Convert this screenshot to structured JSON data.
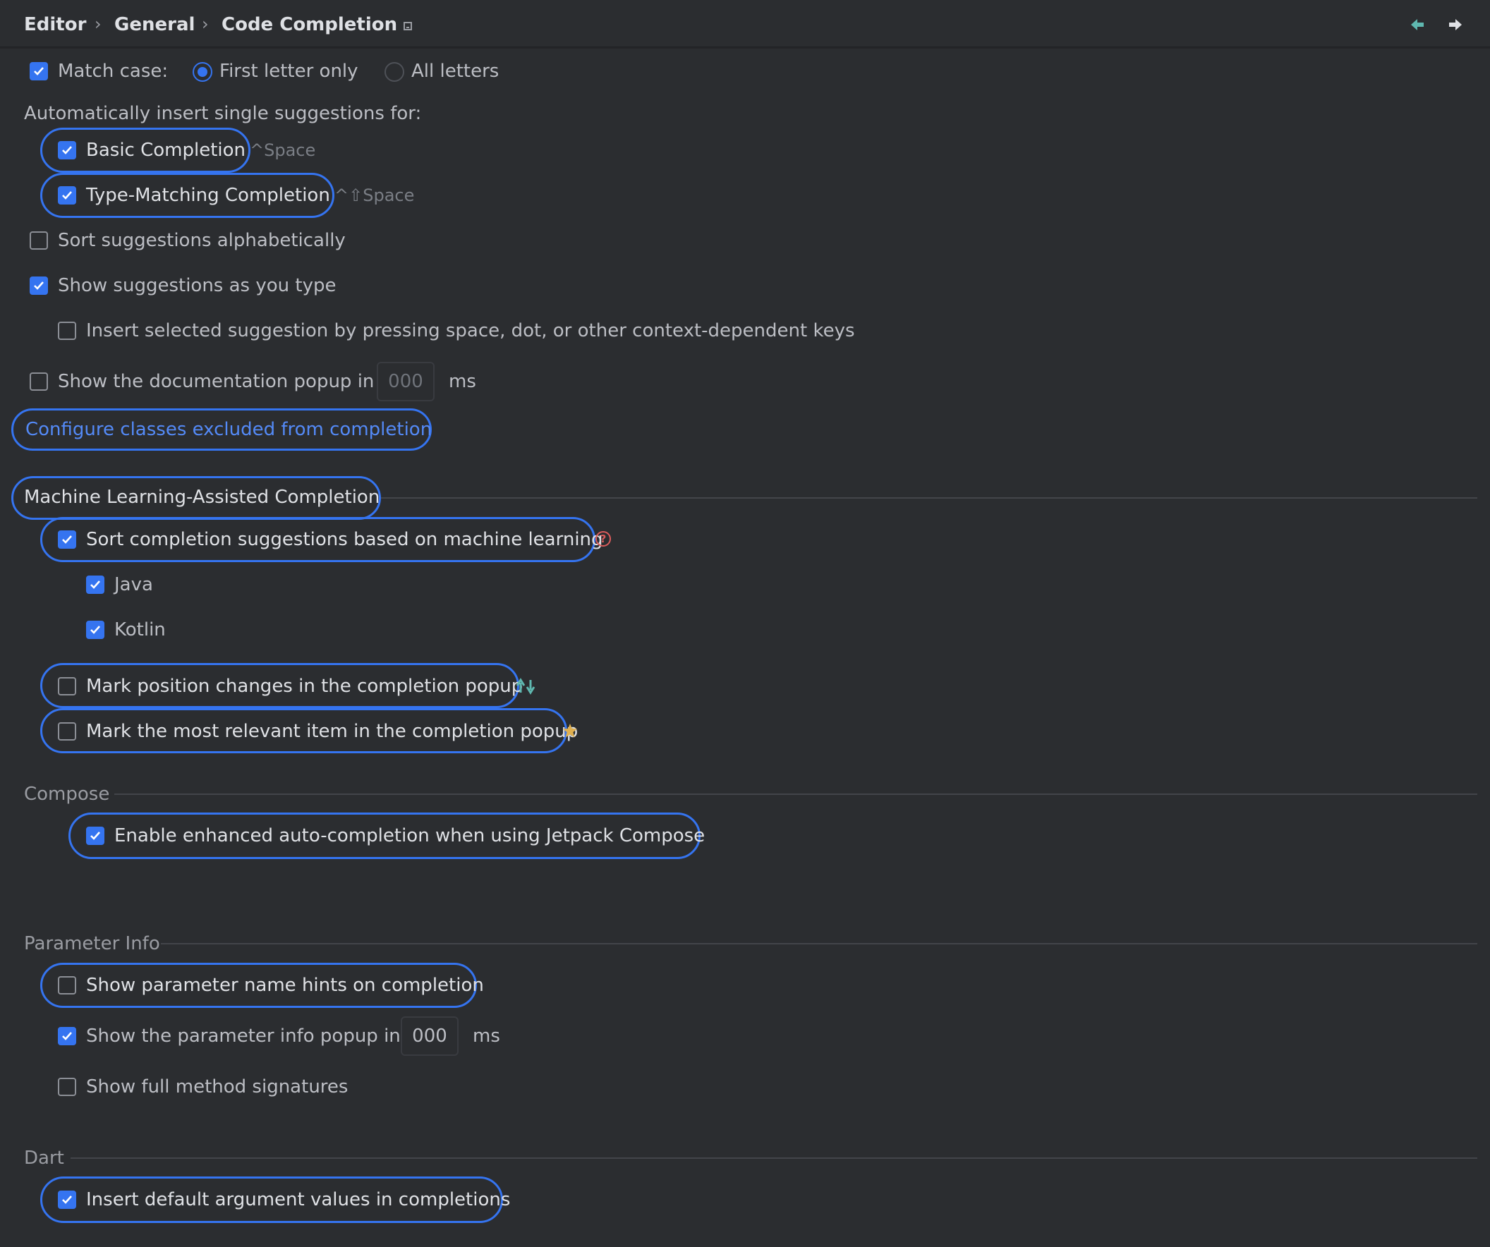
{
  "breadcrumb": [
    "Editor",
    "General",
    "Code Completion"
  ],
  "colors": {
    "accent": "#3574f0",
    "link": "#548af7",
    "background": "#2b2d30",
    "help": "#db5c5c",
    "star": "#e0b050",
    "arrows": "#5fb8b0"
  },
  "match_case": {
    "label": "Match case:",
    "checked": true,
    "options": [
      "First letter only",
      "All letters"
    ],
    "selected": "First letter only"
  },
  "auto_insert": {
    "heading": "Automatically insert single suggestions for:",
    "basic": {
      "label": "Basic Completion",
      "shortcut": "^Space",
      "checked": true
    },
    "type_matching": {
      "label": "Type-Matching Completion",
      "shortcut": "^⇧Space",
      "checked": true
    }
  },
  "sort_alpha": {
    "label": "Sort suggestions alphabetically",
    "checked": false
  },
  "show_as_type": {
    "label": "Show suggestions as you type",
    "checked": true
  },
  "insert_selected": {
    "label": "Insert selected suggestion by pressing space, dot, or other context-dependent keys",
    "checked": false
  },
  "doc_popup": {
    "label": "Show the documentation popup in",
    "value": "000",
    "unit": "ms",
    "checked": false
  },
  "configure_link": "Configure classes excluded from completion",
  "ml": {
    "title": "Machine Learning-Assisted Completion",
    "sort_ml": {
      "label": "Sort completion suggestions based on machine learning",
      "checked": true,
      "help": "?"
    },
    "java": {
      "label": "Java",
      "checked": true
    },
    "kotlin": {
      "label": "Kotlin",
      "checked": true
    },
    "mark_position": {
      "label": "Mark position changes in the completion popup",
      "checked": false,
      "icon": "up-down-arrows-icon"
    },
    "mark_relevant": {
      "label": "Mark the most relevant item in the completion popup",
      "checked": false,
      "icon": "star-icon"
    }
  },
  "compose": {
    "title": "Compose",
    "enhanced": {
      "label": "Enable enhanced auto-completion when using Jetpack Compose",
      "checked": true
    }
  },
  "param_info": {
    "title": "Parameter Info",
    "name_hints": {
      "label": "Show parameter name hints on completion",
      "checked": false
    },
    "info_popup": {
      "label": "Show the parameter info popup in",
      "value": "000",
      "unit": "ms",
      "checked": true
    },
    "full_signatures": {
      "label": "Show full method signatures",
      "checked": false
    }
  },
  "dart": {
    "title": "Dart",
    "default_args": {
      "label": "Insert default argument values in completions",
      "checked": true
    }
  }
}
